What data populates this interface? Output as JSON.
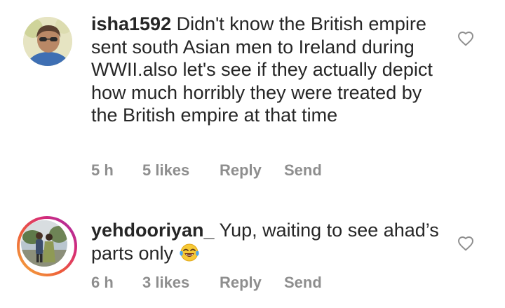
{
  "comments": [
    {
      "username": "isha1592",
      "text": "Didn't know the British empire sent south Asian men to Ireland during WWII.also let's see if they actually depict how much horribly they were treated by the British empire at that time",
      "time": "5 h",
      "likes": "5 likes",
      "reply_label": "Reply",
      "send_label": "Send",
      "has_story_ring": false,
      "heart_icon": "heart-outline-icon"
    },
    {
      "username": "yehdooriyan_",
      "text": "Yup, waiting to see ahad’s parts only",
      "emoji": "face-with-tears-of-joy",
      "time": "6 h",
      "likes": "3 likes",
      "reply_label": "Reply",
      "send_label": "Send",
      "has_story_ring": true,
      "heart_icon": "heart-outline-icon"
    }
  ],
  "colors": {
    "text": "#262626",
    "meta": "#8e8e8e",
    "story_ring": [
      "#f4b33d",
      "#ee5d3a",
      "#d62b77",
      "#9b2fb1"
    ],
    "background": "#ffffff"
  }
}
